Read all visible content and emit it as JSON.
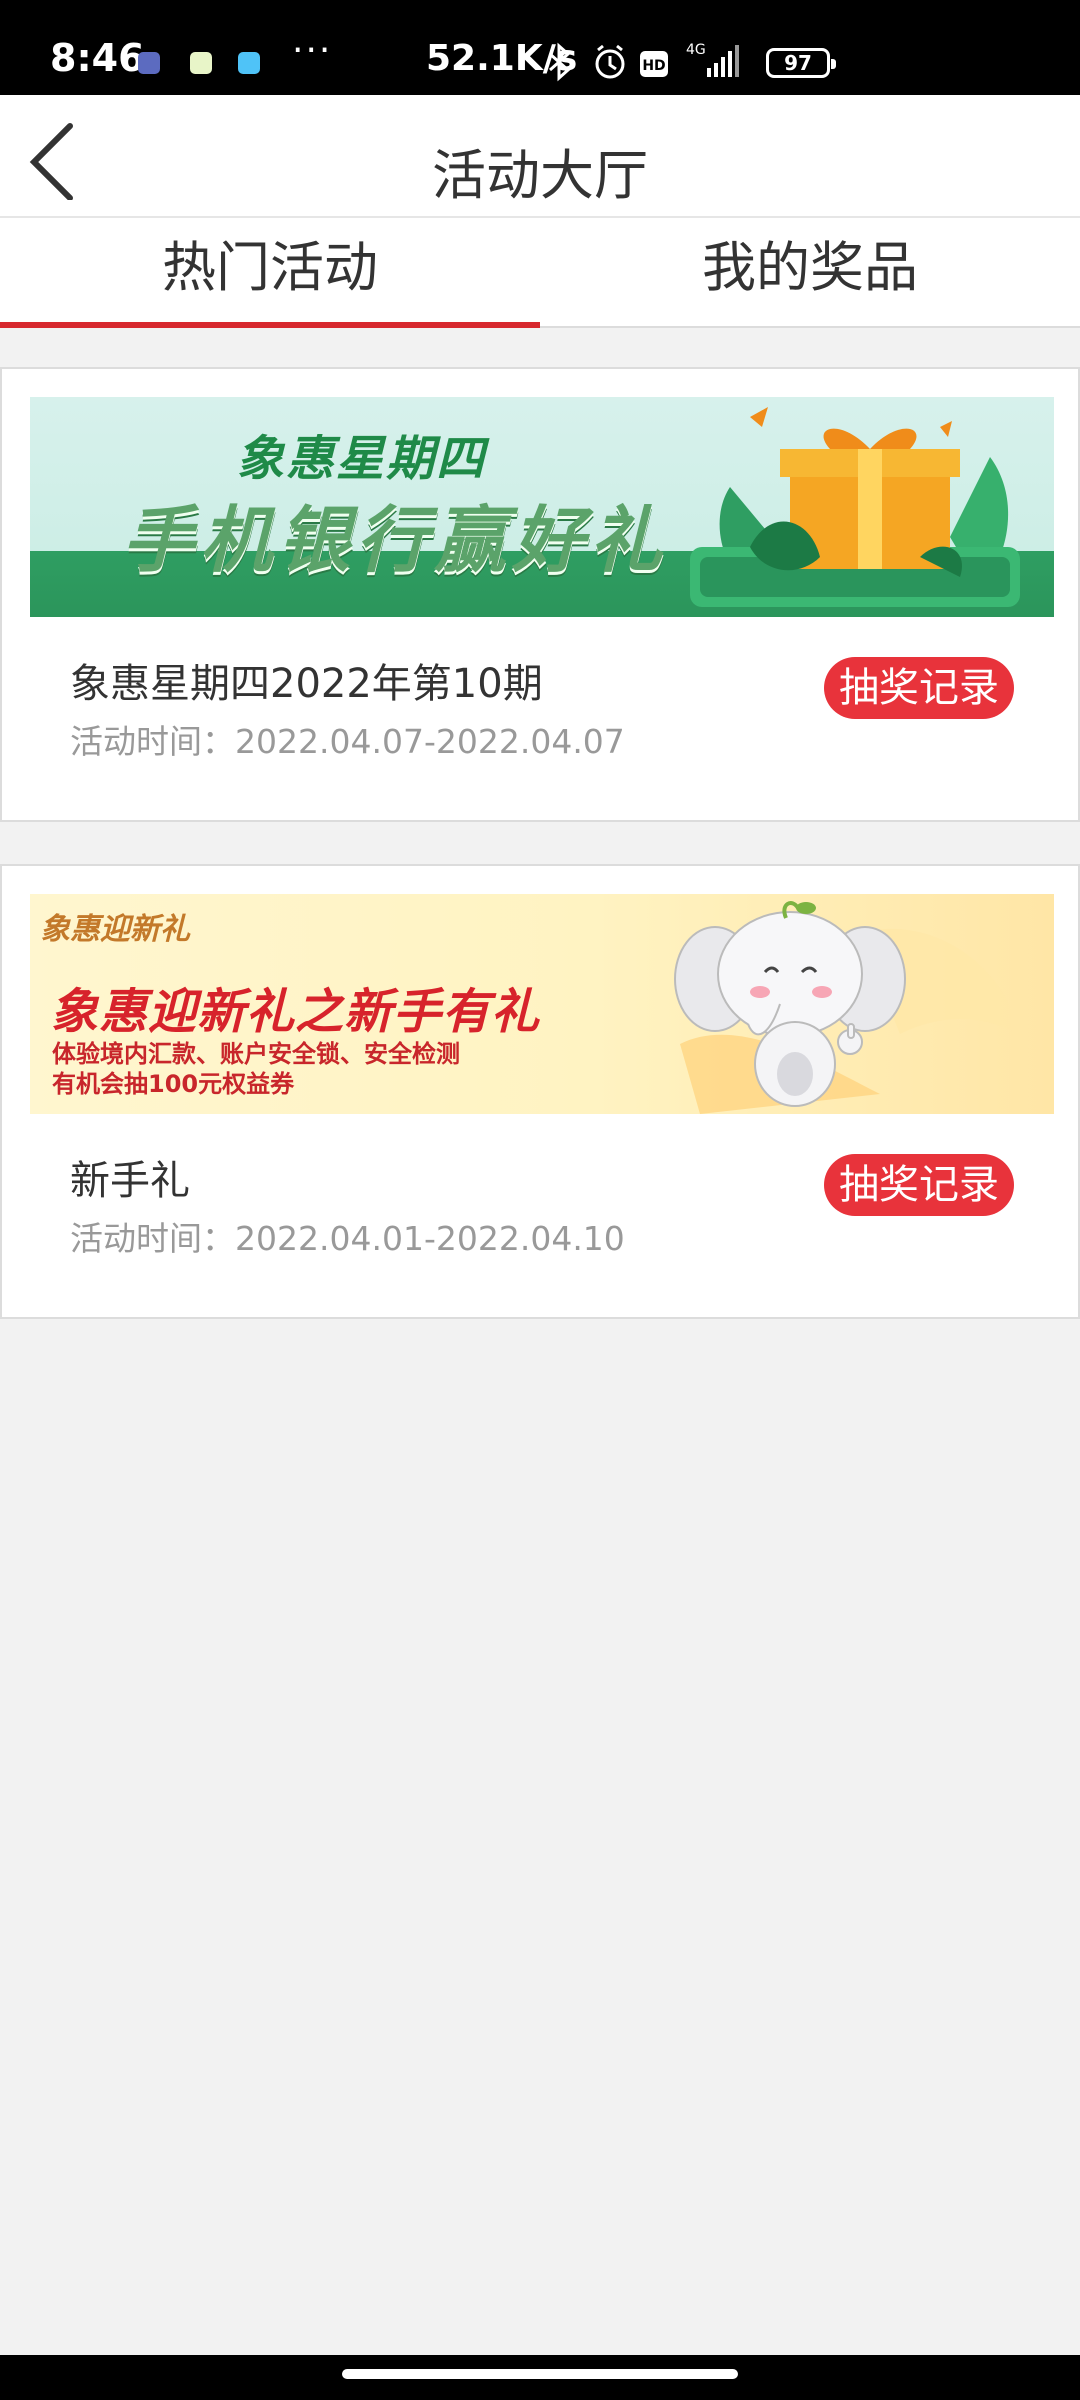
{
  "status_bar": {
    "time": "8:46",
    "more": "···",
    "speed": "52.1K/s",
    "network": "4G",
    "hd": "HD",
    "battery": "97"
  },
  "header": {
    "title": "活动大厅"
  },
  "tabs": [
    {
      "label": "热门活动",
      "active": true
    },
    {
      "label": "我的奖品",
      "active": false
    }
  ],
  "activities": [
    {
      "title": "象惠星期四2022年第10期",
      "time_label": "活动时间：",
      "time_range": "2022.04.07-2022.04.07",
      "button": "抽奖记录",
      "banner": {
        "top_text": "象惠星期四",
        "main_text": "手机银行赢好礼"
      }
    },
    {
      "title": "新手礼",
      "time_label": "活动时间：",
      "time_range": "2022.04.01-2022.04.10",
      "button": "抽奖记录",
      "banner": {
        "logo_text": "象惠迎新礼",
        "main_text": "象惠迎新礼之新手有礼",
        "sub_text_1": "体验境内汇款、账户安全锁、安全检测",
        "sub_text_2": "有机会抽100元权益券"
      }
    }
  ],
  "colors": {
    "accent": "#d7282e",
    "button": "#e8333b",
    "background": "#f2f2f2"
  }
}
